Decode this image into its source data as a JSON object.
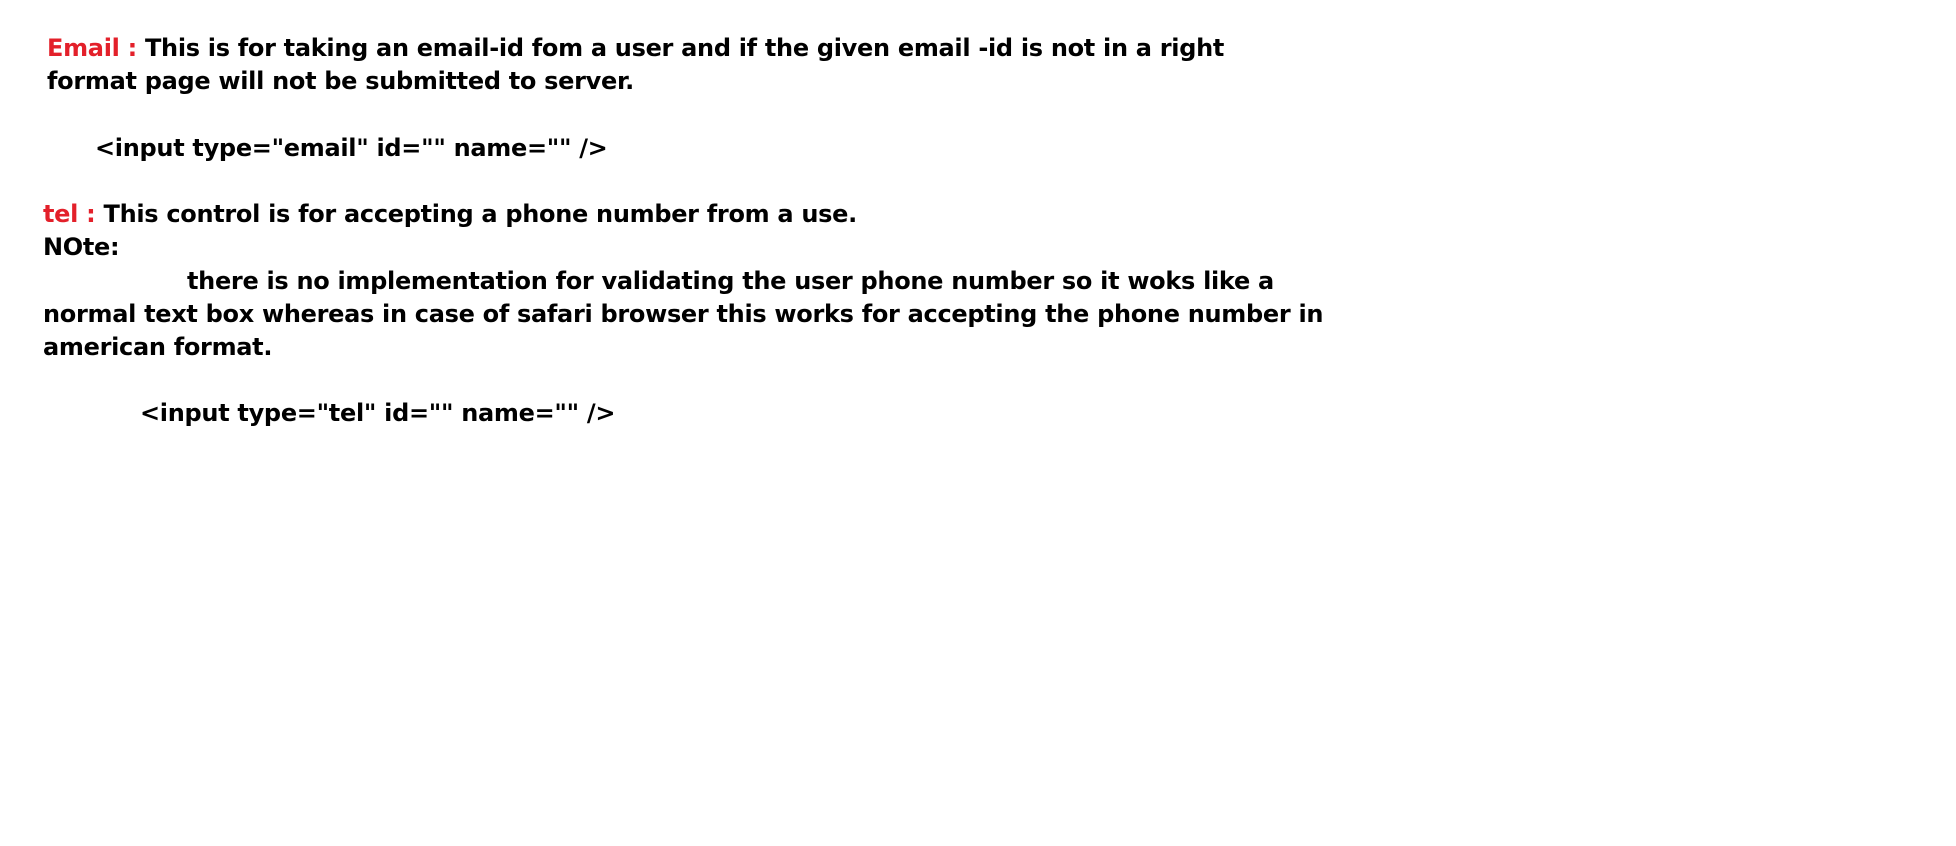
{
  "colors": {
    "keyword": "#e3202a",
    "text": "#000000",
    "background": "#ffffff"
  },
  "email": {
    "keyword": "Email :",
    "description_line1": "This is for taking an email-id fom a user and if the given email -id is not in a right",
    "description_line2": "format page will not be submitted to server.",
    "code": "<input type=\"email\"  id=\"\" name=\"\" />"
  },
  "tel": {
    "keyword": "tel :",
    "description": "This control is for accepting a phone number from a use.",
    "note_label": "NOte:",
    "note_line1": "there is no implementation for validating the user phone number so it woks like a",
    "note_line2": "normal text box whereas in case of safari browser this works for accepting the phone number in",
    "note_line3": "american format.",
    "code": "<input type=\"tel\" id=\"\" name=\"\" />"
  }
}
